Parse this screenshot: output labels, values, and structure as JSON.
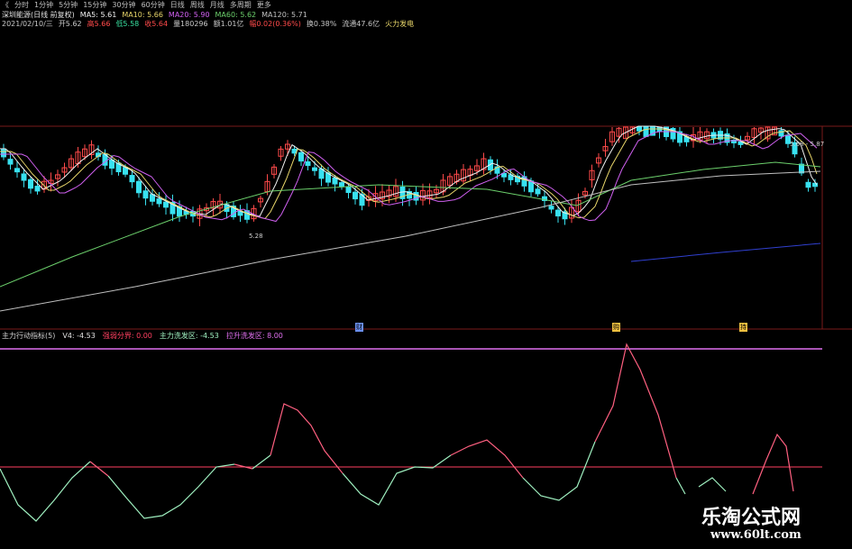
{
  "toolbar": {
    "items": [
      "《",
      "分时",
      "1分钟",
      "5分钟",
      "15分钟",
      "30分钟",
      "60分钟",
      "日线",
      "周线",
      "月线",
      "多周期",
      "更多"
    ]
  },
  "info": {
    "stock": "深圳能源(日线 前复权)",
    "ma5": "MA5: 5.61",
    "ma10": "MA10: 5.66",
    "ma20": "MA20: 5.90",
    "ma60": "MA60: 5.62",
    "ma120": "MA120: 5.71",
    "date": "2021/02/10/三",
    "open": "开5.62",
    "high": "高5.66",
    "low": "低5.58",
    "close": "收5.64",
    "volume": "量180296",
    "amount": "额1.01亿",
    "change": "幅0.02(0.36%)",
    "turnover": "换0.38%",
    "float_cap": "流通47.6亿",
    "sector": "火力发电"
  },
  "price_labels": {
    "low_label": "5.28",
    "high_label": "5.68 - 5.87"
  },
  "markers": [
    "财",
    "购",
    "持"
  ],
  "indicator": {
    "name": "主力行动指标(5)",
    "v4": "V4: -4.53",
    "line1": "强弱分界: 0.00",
    "line2": "主力洗发区: -4.53",
    "line3": "拉升洗发区: 8.00"
  },
  "watermark": {
    "brand": "乐淘公式网",
    "url": "www.60lt.com"
  },
  "colors": {
    "up": "#ff4a4a",
    "down": "#38e1f0",
    "ma5": "#f0f0f0",
    "ma10": "#e8d66a",
    "ma20": "#d060f0",
    "ma60": "#6cd06c",
    "ma120": "#c0c0c0",
    "boundary": "#ff4060",
    "osc_up": "#ff6080",
    "osc_down": "#9ff0c0",
    "topline": "#e070f0"
  }
}
